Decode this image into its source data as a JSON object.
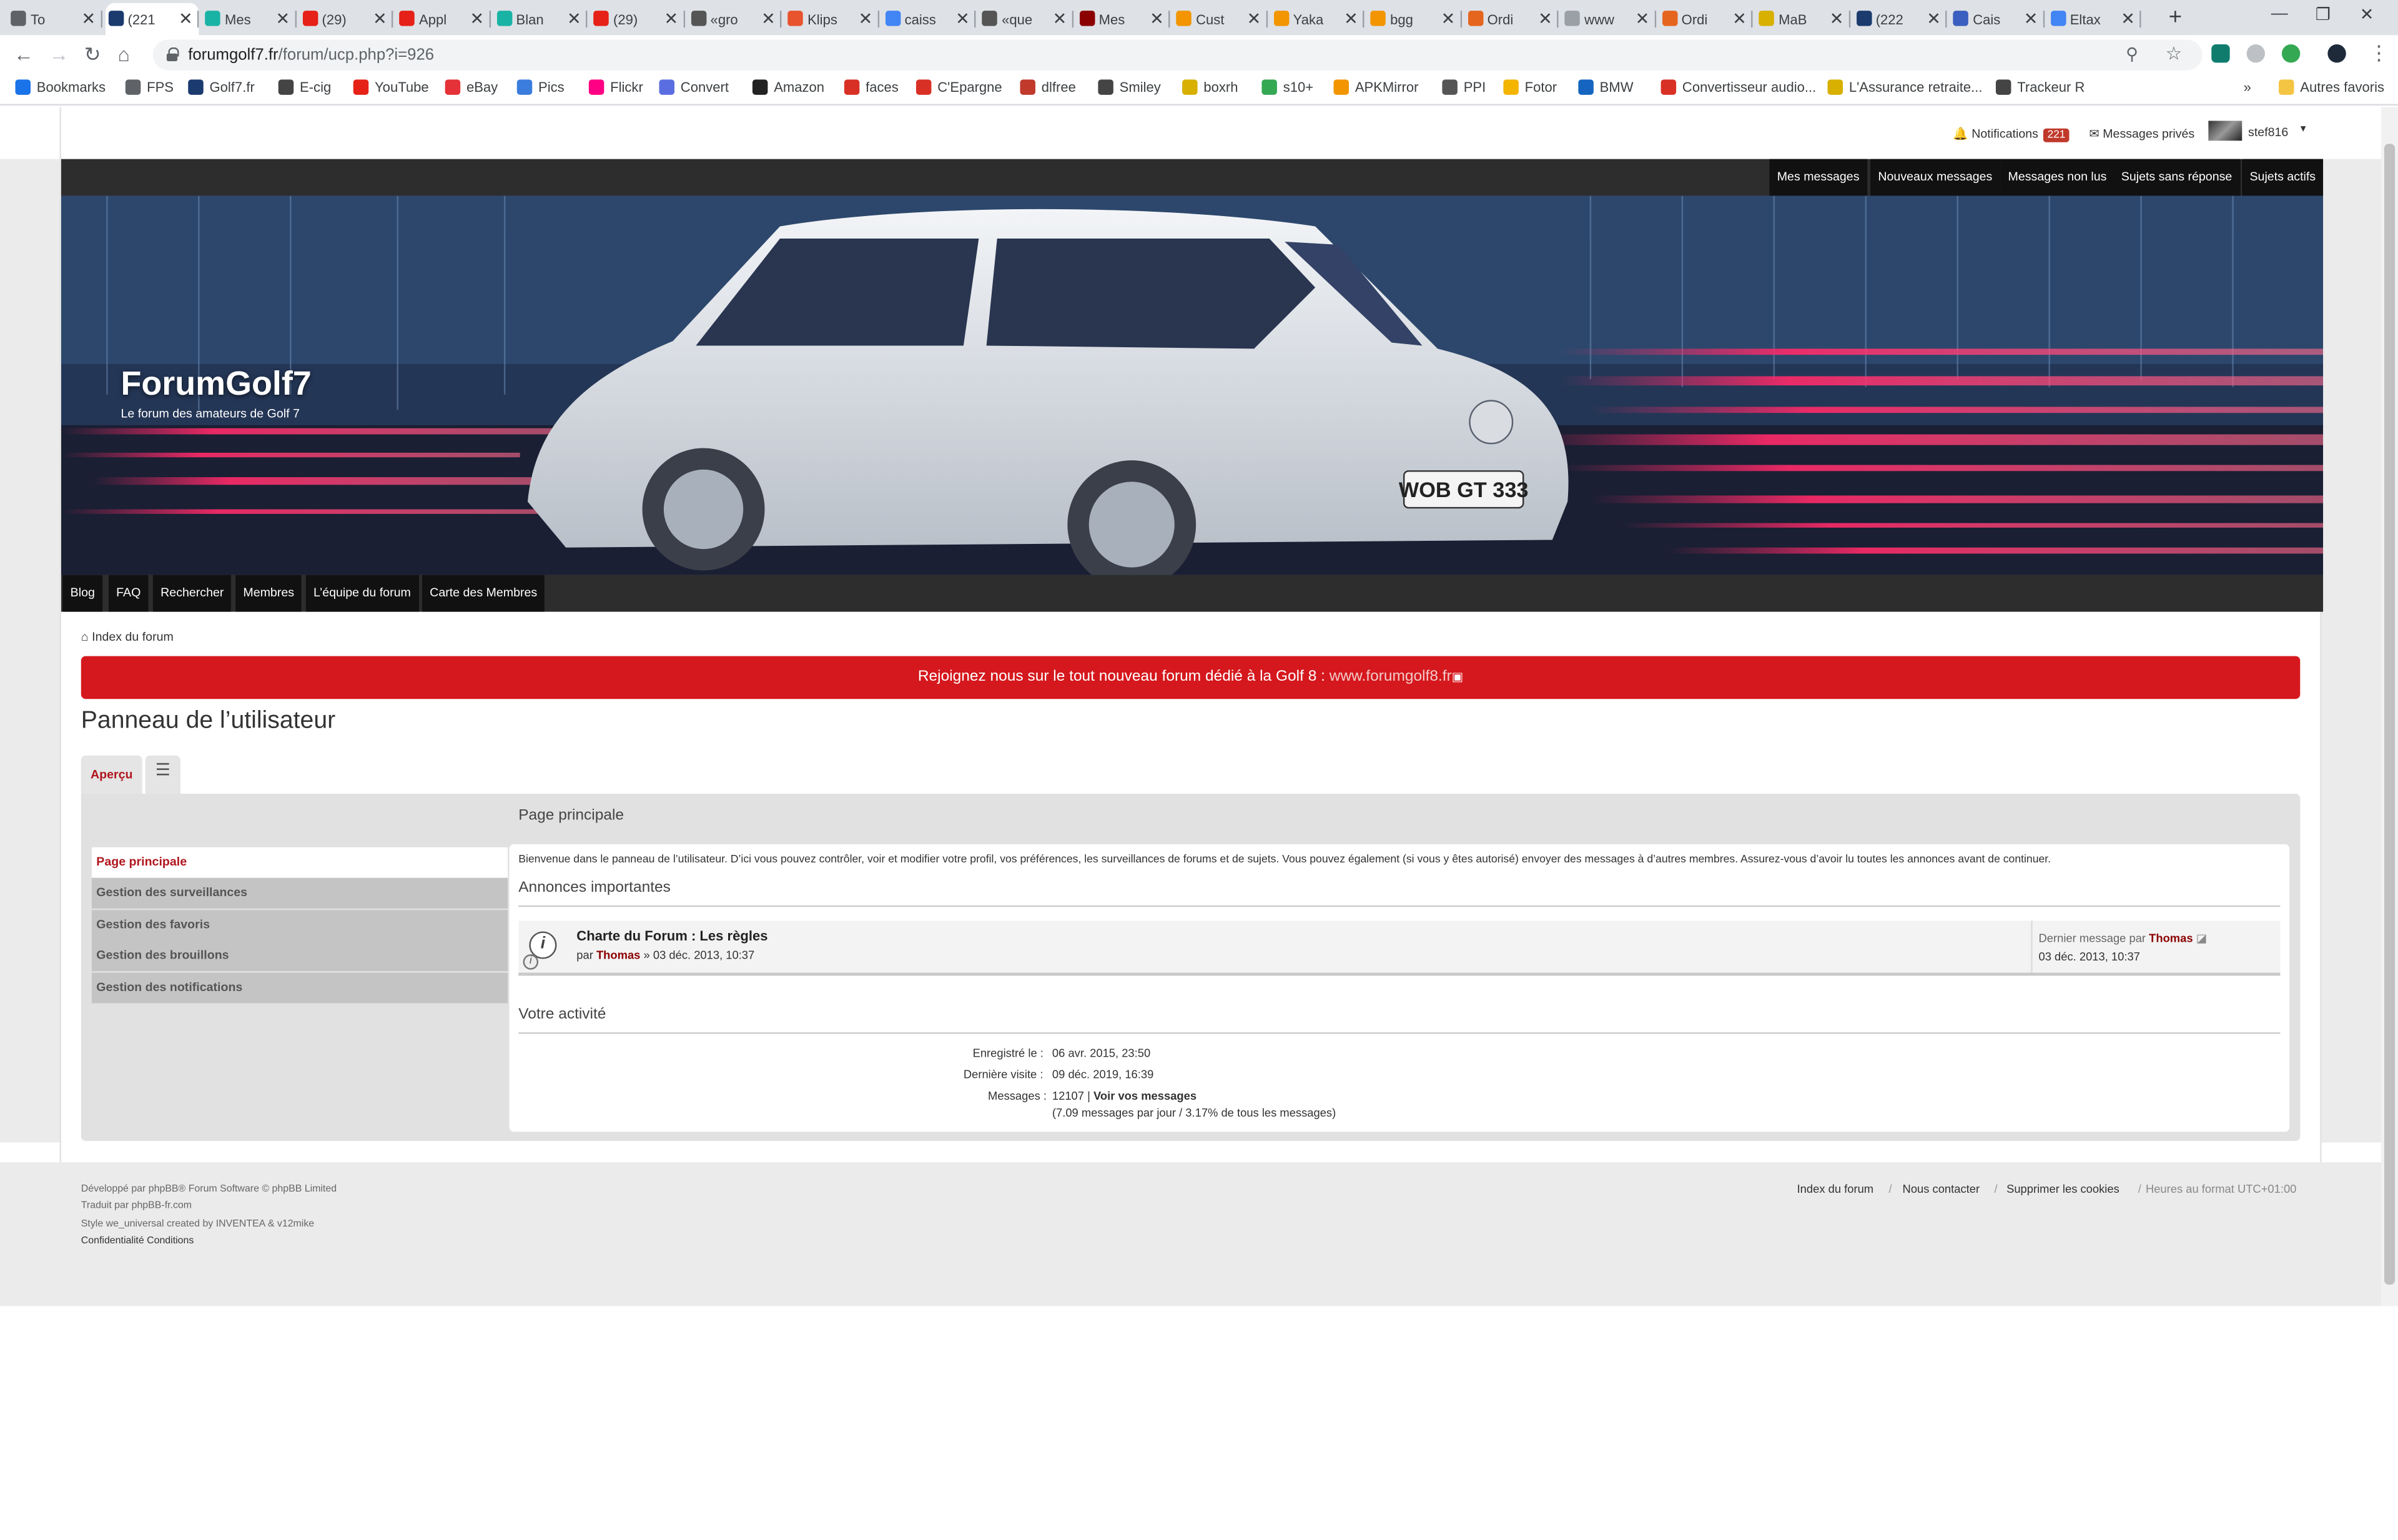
{
  "browser": {
    "tabs": [
      {
        "title": "To",
        "color": "#5f6368"
      },
      {
        "title": "(221",
        "color": "#1b3b6f"
      },
      {
        "title": "Mes",
        "color": "#19b3a5"
      },
      {
        "title": "(29)",
        "color": "#e62117"
      },
      {
        "title": "Appl",
        "color": "#e62117"
      },
      {
        "title": "Blan",
        "color": "#19b3a5"
      },
      {
        "title": "(29)",
        "color": "#e62117"
      },
      {
        "title": "«gro",
        "color": "#555555"
      },
      {
        "title": "Klips",
        "color": "#e8542e"
      },
      {
        "title": "caiss",
        "color": "#4285f4"
      },
      {
        "title": "«que",
        "color": "#555555"
      },
      {
        "title": "Mes",
        "color": "#8b0000"
      },
      {
        "title": "Cust",
        "color": "#f29500"
      },
      {
        "title": "Yaka",
        "color": "#f29500"
      },
      {
        "title": "bgg",
        "color": "#f29500"
      },
      {
        "title": "Ordi",
        "color": "#e5651e"
      },
      {
        "title": "www",
        "color": "#9aa0a6"
      },
      {
        "title": "Ordi",
        "color": "#e5651e"
      },
      {
        "title": "MaB",
        "color": "#d8b000"
      },
      {
        "title": "(222",
        "color": "#1b3b6f"
      },
      {
        "title": "Cais",
        "color": "#3b5fc0"
      },
      {
        "title": "Eltax",
        "color": "#4285f4"
      }
    ],
    "url_domain": "forumgolf7.fr",
    "url_path": "/forum/ucp.php?i=926",
    "bookmarks": [
      {
        "label": "Bookmarks",
        "color": "#1a73e8"
      },
      {
        "label": "FPS",
        "color": "#5f6368"
      },
      {
        "label": "Golf7.fr",
        "color": "#1b3b6f"
      },
      {
        "label": "E-cig",
        "color": "#444444"
      },
      {
        "label": "YouTube",
        "color": "#e62117"
      },
      {
        "label": "eBay",
        "color": "#e53238"
      },
      {
        "label": "Pics",
        "color": "#3b7ddd"
      },
      {
        "label": "Flickr",
        "color": "#ff0084"
      },
      {
        "label": "Convert",
        "color": "#5b6ee1"
      },
      {
        "label": "Amazon",
        "color": "#222222"
      },
      {
        "label": "faces",
        "color": "#d93025"
      },
      {
        "label": "C'Epargne",
        "color": "#d93025"
      },
      {
        "label": "dlfree",
        "color": "#c0392b"
      },
      {
        "label": "Smiley",
        "color": "#444444"
      },
      {
        "label": "boxrh",
        "color": "#d8b000"
      },
      {
        "label": "s10+",
        "color": "#34a853"
      },
      {
        "label": "APKMirror",
        "color": "#f29500"
      },
      {
        "label": "PPI",
        "color": "#555555"
      },
      {
        "label": "Fotor",
        "color": "#f4b400"
      },
      {
        "label": "BMW",
        "color": "#1565c0"
      },
      {
        "label": "Convertisseur audio...",
        "color": "#d93025"
      },
      {
        "label": "L'Assurance retraite...",
        "color": "#d8b000"
      },
      {
        "label": "Trackeur R",
        "color": "#444444"
      }
    ],
    "other_bookmarks": "Autres favoris",
    "chevron": "»"
  },
  "forum": {
    "topbar": {
      "notifications_label": "Notifications",
      "notifications_count": "221",
      "private_messages": "Messages privés",
      "username": "stef816"
    },
    "top_links": [
      "Mes messages",
      "Nouveaux messages",
      "Messages non lus",
      "Sujets sans réponse",
      "Sujets actifs"
    ],
    "site_title": "ForumGolf7",
    "site_description": "Le forum des amateurs de Golf 7",
    "nav_links": [
      "Blog",
      "FAQ",
      "Rechercher",
      "Membres",
      "L’équipe du forum",
      "Carte des Membres"
    ],
    "breadcrumb": "Index du forum",
    "announcement_text": "Rejoignez nous sur le tout nouveau forum dédié à la Golf 8 : ",
    "announcement_link": "www.forumgolf8.fr",
    "page_title": "Panneau de l’utilisateur",
    "tab_overview": "Aperçu",
    "side_menu": [
      "Page principale",
      "Gestion des surveillances",
      "Gestion des favoris",
      "Gestion des brouillons",
      "Gestion des notifications"
    ],
    "main_heading": "Page principale",
    "welcome_text": "Bienvenue dans le panneau de l’utilisateur. D’ici vous pouvez contrôler, voir et modifier votre profil, vos préférences, les surveillances de forums et de sujets. Vous pouvez également (si vous y êtes autorisé) envoyer des messages à d’autres membres. Assurez-vous d’avoir lu toutes les annonces avant de continuer.",
    "announcements_heading": "Annonces importantes",
    "topic": {
      "title": "Charte du Forum : Les règles",
      "by": "par",
      "author": "Thomas",
      "date": "» 03 déc. 2013, 10:37",
      "last_post_label": "Dernier message par",
      "last_post_author": "Thomas",
      "last_post_date": "03 déc. 2013, 10:37"
    },
    "activity_heading": "Votre activité",
    "activity": {
      "registered_label": "Enregistré le :",
      "registered_value": "06 avr. 2015, 23:50",
      "last_visit_label": "Dernière visite :",
      "last_visit_value": "09 déc. 2019, 16:39",
      "messages_label": "Messages :",
      "messages_value": "12107 |",
      "messages_link": "Voir vos messages",
      "messages_stats": "(7.09 messages par jour / 3.17% de tous les messages)"
    },
    "footer": {
      "line1": "Développé par phpBB® Forum Software © phpBB Limited",
      "line2": "Traduit par phpBB-fr.com",
      "line3": "Style we_universal created by INVENTEA & v12mike",
      "line4": "Confidentialité Conditions",
      "links": [
        "Index du forum",
        "Nous contacter",
        "Supprimer les cookies"
      ],
      "timezone": "Heures au format UTC+01:00"
    }
  }
}
